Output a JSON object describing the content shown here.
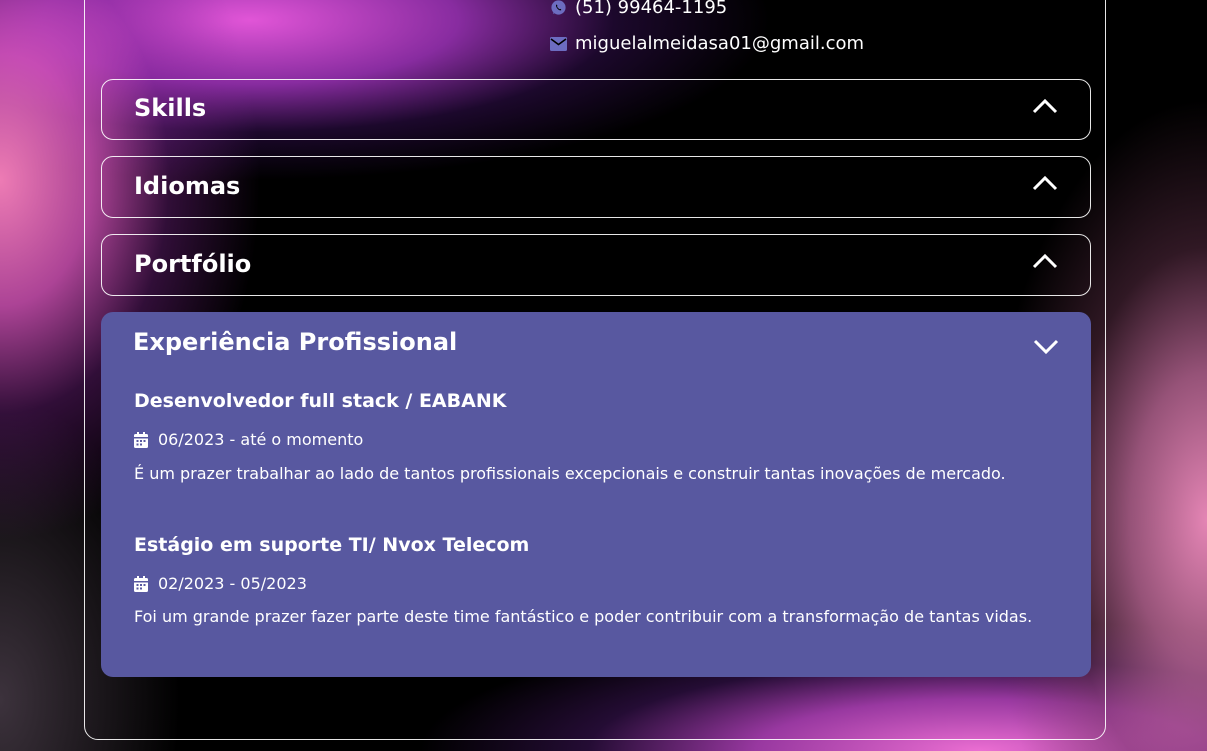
{
  "contact": {
    "phone": "(51) 99464-1195",
    "phone_icon": "whatsapp-icon",
    "email": "miguelalmeidasa01@gmail.com",
    "email_icon": "envelope-icon"
  },
  "sections": {
    "skills": {
      "label": "Skills",
      "icon": "chevron-up-icon",
      "expanded": false
    },
    "idiomas": {
      "label": "Idiomas",
      "icon": "chevron-up-icon",
      "expanded": false
    },
    "portfolio": {
      "label": "Portfólio",
      "icon": "chevron-up-icon",
      "expanded": false
    },
    "experiencia": {
      "label": "Experiência Profissional",
      "icon": "chevron-down-icon",
      "expanded": true,
      "jobs": [
        {
          "title": "Desenvolvedor full stack / EABANK",
          "date": "06/2023 - até o momento",
          "description": "É um prazer trabalhar ao lado de tantos profissionais excepcionais e construir tantas inovações de mercado."
        },
        {
          "title": "Estágio em suporte TI/ Nvox Telecom",
          "date": "02/2023 - 05/2023",
          "description": "Foi um grande prazer fazer parte deste time fantástico e poder contribuir com a transformação de tantas vidas."
        }
      ]
    }
  },
  "colors": {
    "panel_expanded": "#5858a0",
    "icon_accent": "#6c6cc0",
    "background": "#000000"
  }
}
